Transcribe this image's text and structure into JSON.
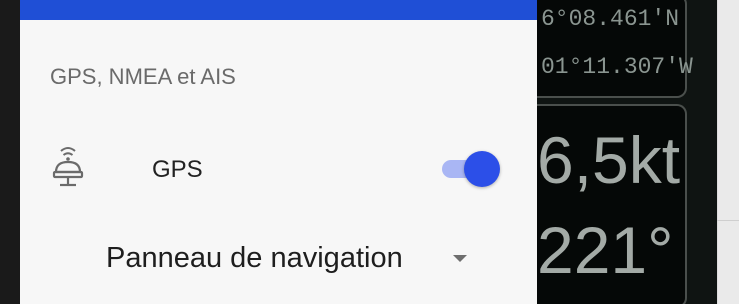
{
  "drawer": {
    "section_title": "GPS, NMEA et AIS",
    "gps": {
      "label": "GPS",
      "enabled": true,
      "icon": "gps-antenna-icon"
    },
    "dashboard_select": {
      "value": "Panneau de navigation",
      "icon": "dropdown-caret-icon"
    }
  },
  "instrument": {
    "latitude": "6°08.461'N",
    "longitude": "01°11.307'W",
    "speed": "6,5kt",
    "heading": "221°"
  },
  "colors": {
    "accent": "#2c4fe8",
    "drawer_top_bar": "#1f4fd6",
    "instrument_bg": "#050807"
  }
}
